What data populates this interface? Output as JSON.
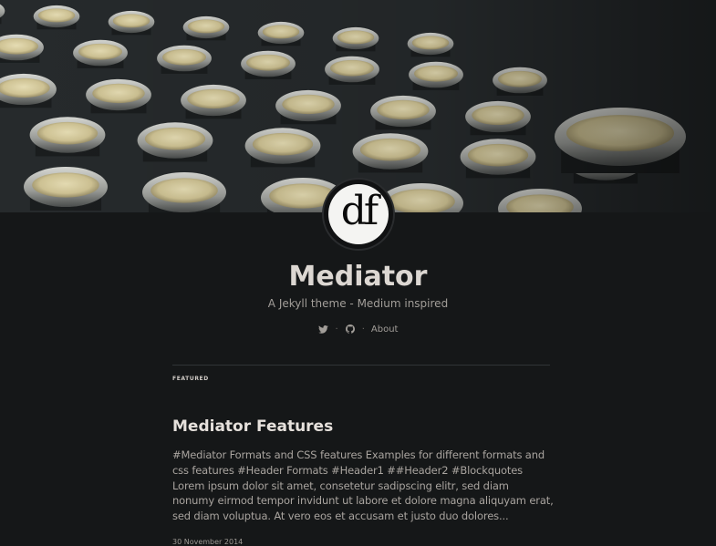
{
  "header": {
    "avatar_text": "df",
    "title": "Mediator",
    "description": "A Jekyll theme - Medium inspired",
    "nav": {
      "icons": [
        "twitter-icon",
        "github-icon"
      ],
      "separator": "·",
      "about_label": "About"
    }
  },
  "section": {
    "label": "FEATURED"
  },
  "posts": [
    {
      "title": "Mediator Features",
      "excerpt": "#Mediator Formats and CSS features Examples for different formats and css features #Header Formats #Header1 ##Header2 #Blockquotes Lorem ipsum dolor sit amet, consetetur sadipscing elitr, sed diam nonumy eirmod tempor invidunt ut labore et dolore magna aliquyam erat, sed diam voluptua. At vero eos et accusam et justo duo dolores...",
      "date": "30 November 2014"
    }
  ],
  "colors": {
    "background": "#151718",
    "title": "#dcd7d2",
    "text": "#a9a49f"
  }
}
